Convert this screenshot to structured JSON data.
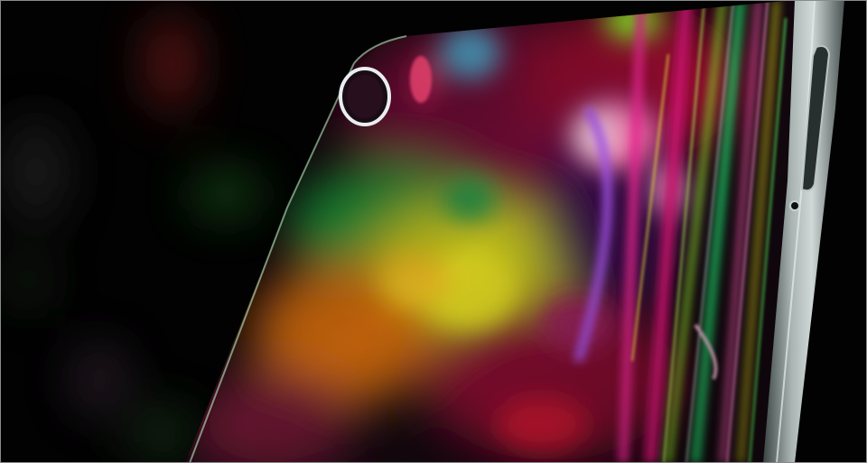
{
  "scene": {
    "subject": "smartphone-glass-back",
    "background_color": "#020202",
    "palette": {
      "magenta": "#e0167a",
      "pink": "#ff5fb3",
      "lime": "#9cff2a",
      "green": "#22d46a",
      "yellow": "#e8e020",
      "red": "#d8202a",
      "cyan": "#4fb6e0",
      "violet": "#b45cff",
      "frame_silver": "#9aa6a6"
    }
  }
}
